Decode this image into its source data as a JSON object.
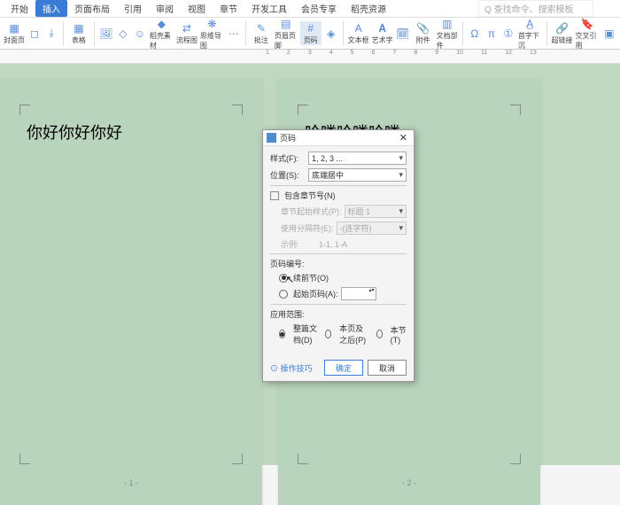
{
  "tabs": {
    "t0": "开始",
    "t1": "插入",
    "t2": "页面布局",
    "t3": "引用",
    "t4": "审阅",
    "t5": "视图",
    "t6": "章节",
    "t7": "开发工具",
    "t8": "会员专享",
    "t9": "稻壳资源",
    "search_placeholder": "Q 查找命令、搜索模板"
  },
  "ribbon": {
    "cover": "封面页",
    "blank": "空白页",
    "break": "分页",
    "table": "表格",
    "pic": "图片",
    "shape": "形状",
    "icon": "图标",
    "docsrc": "稻壳素材",
    "process": "流程图",
    "mind": "思维导图",
    "more": "更多",
    "batch": "批注",
    "hf": "页眉页脚",
    "pgnum": "页码",
    "wm": "水印",
    "textbox": "文本框",
    "art": "艺术字",
    "date": "日期",
    "attach": "附件",
    "field": "文档部件",
    "symbol": "符号",
    "eq": "公式",
    "num": "编号",
    "dropcap": "首字下沉",
    "link": "超链接",
    "bm": "交叉引用",
    "obj": "对象"
  },
  "pages": {
    "left_text": "你好你好你好",
    "right_text": "哈喽哈喽哈喽",
    "left_num": "- 1 -",
    "right_num": "- 2 -"
  },
  "dialog": {
    "title": "页码",
    "fmt_label": "样式(F):",
    "fmt_value": "1, 2, 3 ...",
    "pos_label": "位置(S):",
    "pos_value": "底端居中",
    "chapter_chk": "包含章节号(N)",
    "chap_style_label": "章节起始样式(P):",
    "chap_style_value": "标题 1",
    "chap_sep_label": "使用分隔符(E):",
    "chap_sep_value": "-(连字符)",
    "example_label": "示例:",
    "example_value": "1-1,  1-A",
    "num_section": "页码编号:",
    "continue_radio": "续前节(O)",
    "startat_radio": "起始页码(A):",
    "apply_section": "应用范围:",
    "apply_whole": "整篇文档(D)",
    "apply_frompos": "本页及之后(P)",
    "apply_section_only": "本节(T)",
    "help": "⊙ 操作技巧",
    "ok": "确定",
    "cancel": "取消"
  }
}
